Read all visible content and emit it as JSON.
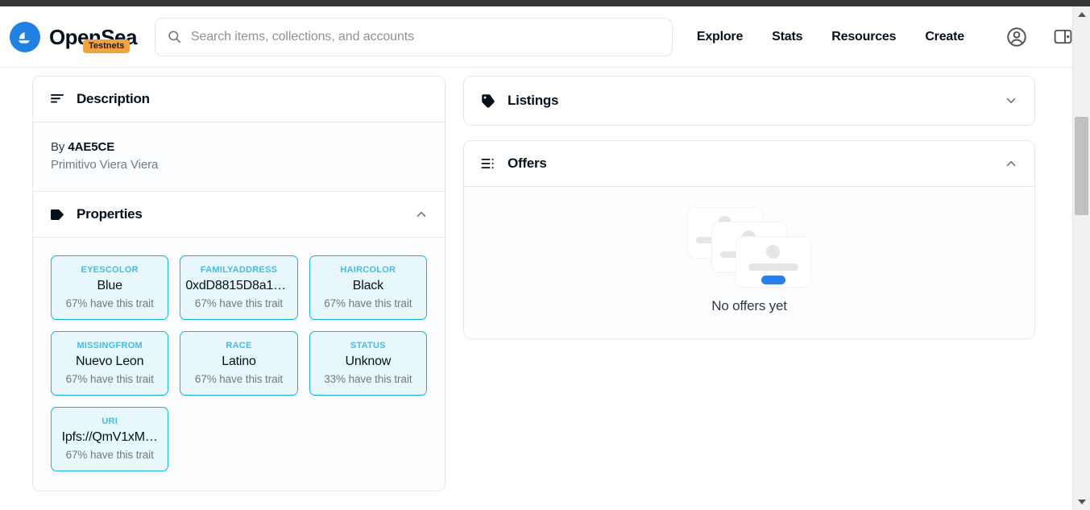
{
  "browser": {
    "scrollbar": {
      "up_arrow_icon": "triangle-up-icon",
      "down_arrow_icon": "triangle-down-icon"
    }
  },
  "header": {
    "brand": {
      "name": "OpenSea",
      "badge": "Testnets",
      "logo_icon": "opensea-sailboat-logo-icon"
    },
    "search": {
      "placeholder": "Search items, collections, and accounts",
      "value": "",
      "icon": "search-icon"
    },
    "nav_links": [
      {
        "label": "Explore"
      },
      {
        "label": "Stats"
      },
      {
        "label": "Resources"
      },
      {
        "label": "Create"
      }
    ],
    "icons": [
      {
        "name": "account-icon"
      },
      {
        "name": "wallet-icon"
      }
    ]
  },
  "description_card": {
    "title": "Description",
    "icon": "list-lines-icon",
    "by_prefix": "By ",
    "by_name": "4AE5CE",
    "text": "Primitivo Viera Viera"
  },
  "properties_card": {
    "title": "Properties",
    "icon": "tag-filled-icon",
    "collapse_icon": "chevron-up-icon",
    "traits": [
      {
        "type": "EYESCOLOR",
        "value": "Blue",
        "rarity": "67% have this trait"
      },
      {
        "type": "FAMILYADDRESS",
        "value": "0xdD8815D8a1F…",
        "rarity": "67% have this trait"
      },
      {
        "type": "HAIRCOLOR",
        "value": "Black",
        "rarity": "67% have this trait"
      },
      {
        "type": "MISSINGFROM",
        "value": "Nuevo Leon",
        "rarity": "67% have this trait"
      },
      {
        "type": "RACE",
        "value": "Latino",
        "rarity": "67% have this trait"
      },
      {
        "type": "STATUS",
        "value": "Unknow",
        "rarity": "33% have this trait"
      },
      {
        "type": "URI",
        "value": "Ipfs://QmV1xM…",
        "rarity": "67% have this trait"
      }
    ]
  },
  "listings_card": {
    "title": "Listings",
    "icon": "price-tag-icon",
    "expand_icon": "chevron-down-icon"
  },
  "offers_card": {
    "title": "Offers",
    "icon": "list-bullet-icon",
    "collapse_icon": "chevron-up-icon",
    "empty_text": "No offers yet",
    "empty_illustration_icon": "stacked-cards-icon"
  },
  "colors": {
    "brand_blue": "#2081e2",
    "badge_orange": "#f3a33e",
    "trait_border": "#15b2e5",
    "trait_bg": "#e8f7fc",
    "trait_label": "#44bbe6",
    "text_primary": "#04111d",
    "text_muted": "#707a83",
    "card_border": "#e5e8eb",
    "empty_pill_blue": "#2a7fe8"
  }
}
